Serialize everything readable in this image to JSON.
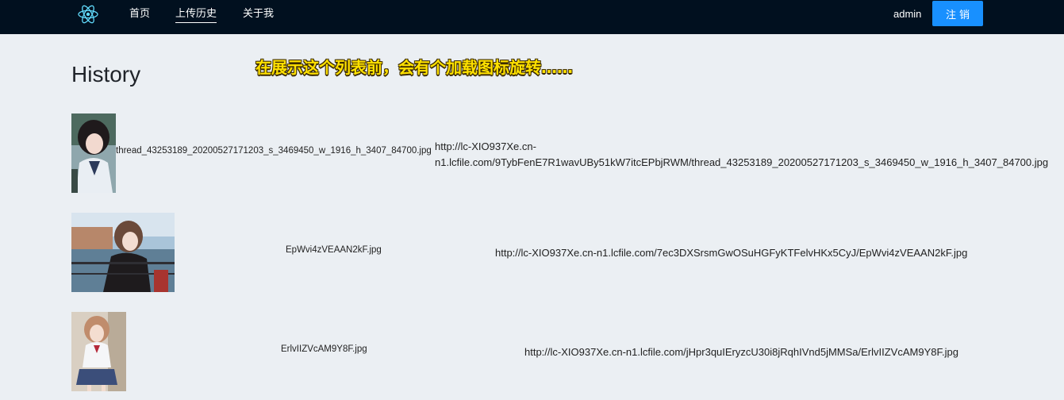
{
  "nav": {
    "logo_icon": "react-logo-icon",
    "items": [
      {
        "label": "首页",
        "active": false
      },
      {
        "label": "上传历史",
        "active": true
      },
      {
        "label": "关于我",
        "active": false
      }
    ],
    "user": "admin",
    "logout_label": "注销"
  },
  "page": {
    "title": "History",
    "annotation": "在展示这个列表前，会有个加载图标旋转……"
  },
  "history": [
    {
      "thumb_icon": "photo-thumbnail",
      "filename": "thread_43253189_20200527171203_s_3469450_w_1916_h_3407_84700.jpg",
      "url": "http://lc-XIO937Xe.cn-n1.lcfile.com/9TybFenE7R1wavUBy51kW7itcEPbjRWM/thread_43253189_20200527171203_s_3469450_w_1916_h_3407_84700.jpg"
    },
    {
      "thumb_icon": "photo-thumbnail",
      "filename": "EpWvi4zVEAAN2kF.jpg",
      "url": "http://lc-XIO937Xe.cn-n1.lcfile.com/7ec3DXSrsmGwOSuHGFyKTFelvHKx5CyJ/EpWvi4zVEAAN2kF.jpg"
    },
    {
      "thumb_icon": "photo-thumbnail",
      "filename": "ErlvIIZVcAM9Y8F.jpg",
      "url": "http://lc-XIO937Xe.cn-n1.lcfile.com/jHpr3quIEryzcU30i8jRqhIVnd5jMMSa/ErlvIIZVcAM9Y8F.jpg"
    }
  ]
}
